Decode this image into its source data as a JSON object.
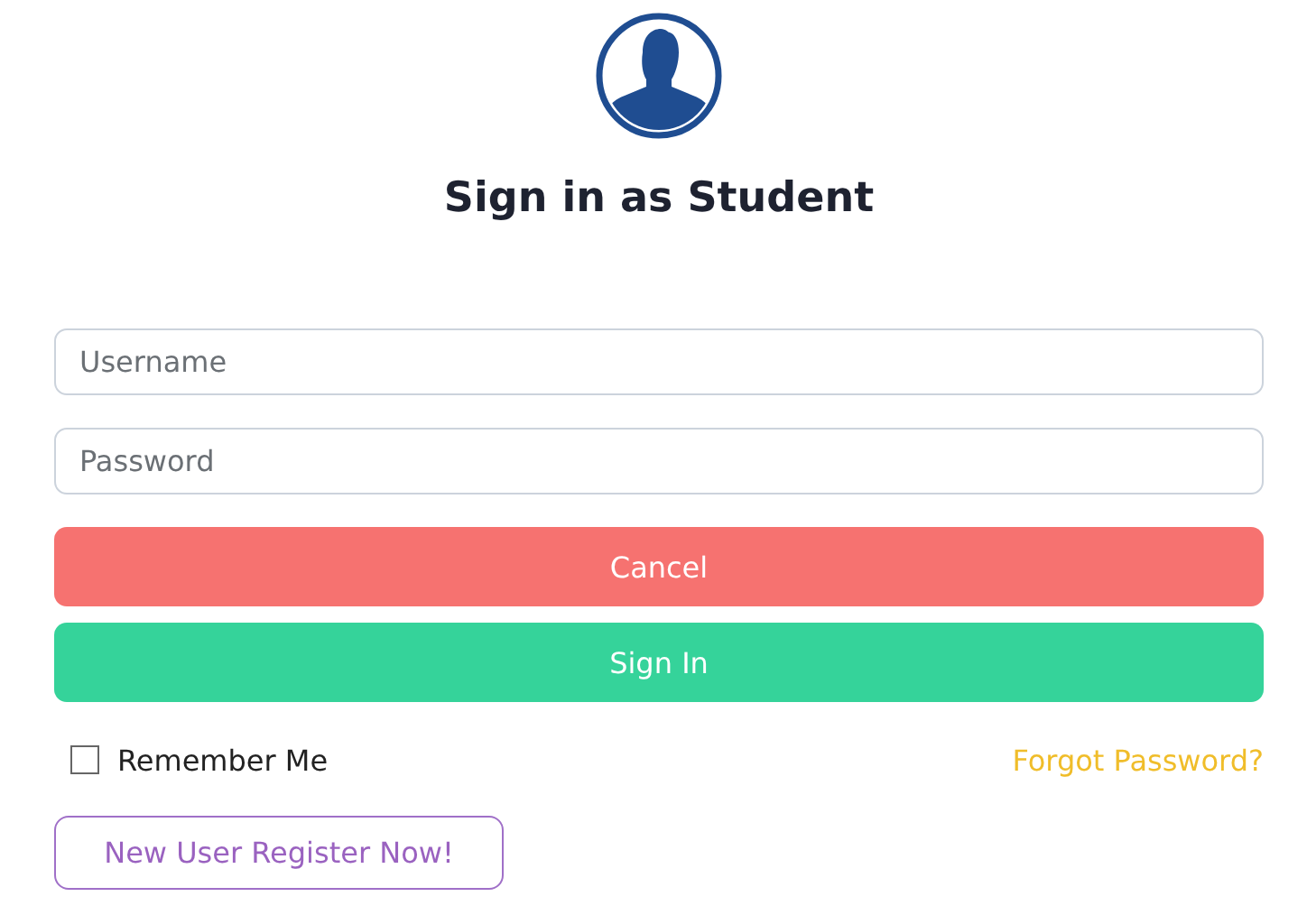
{
  "title": "Sign in as Student",
  "fields": [
    {
      "placeholder": "Username"
    },
    {
      "placeholder": "Password"
    }
  ],
  "buttons": [
    {
      "label": "Cancel",
      "kind": "cancel"
    },
    {
      "label": "Sign In",
      "kind": "primary"
    }
  ],
  "remember": {
    "label": "Remember Me",
    "checked": false
  },
  "forgot_link": "Forgot Password?",
  "register_button": "New User Register Now!"
}
